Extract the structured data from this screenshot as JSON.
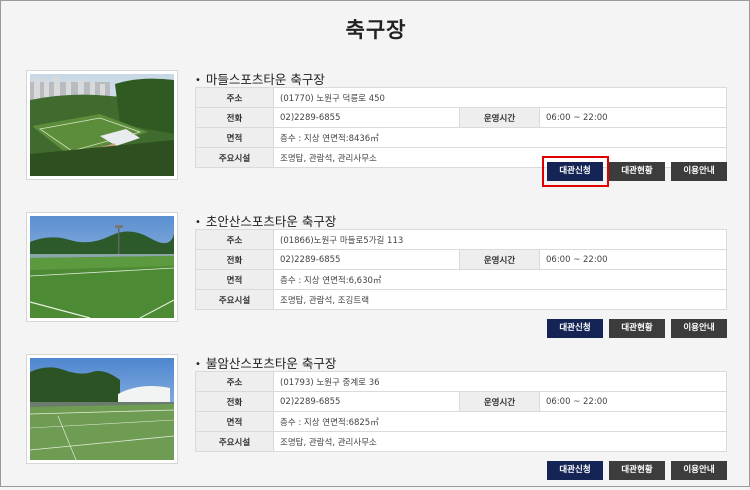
{
  "page": {
    "title": "축구장"
  },
  "labels": {
    "address": "주소",
    "phone": "전화",
    "hours": "운영시간",
    "area": "면적",
    "facilities": "주요시설"
  },
  "buttons": {
    "apply": "대관신청",
    "status": "대관현황",
    "guide": "이용안내"
  },
  "venues": [
    {
      "name": "마들스포츠타운 축구장",
      "address": "(01770) 노원구 덕릉로 450",
      "phone": "02)2289-6855",
      "hours": "06:00 ~ 22:00",
      "area": "층수 : 지상 연면적:8436㎡",
      "facilities": "조명탑, 관람석, 관리사무소"
    },
    {
      "name": "초안산스포츠타운 축구장",
      "address": "(01866)노원구 마들로5가길 113",
      "phone": "02)2289-6855",
      "hours": "06:00 ~ 22:00",
      "area": "층수 : 지상 연면적:6,630㎡",
      "facilities": "조명탑, 관람석, 조깅트랙"
    },
    {
      "name": "불암산스포츠타운 축구장",
      "address": "(01793) 노원구 중계로 36",
      "phone": "02)2289-6855",
      "hours": "06:00 ~ 22:00",
      "area": "층수 : 지상 연면적:6825㎡",
      "facilities": "조명탑, 관람석, 관리사무소"
    }
  ]
}
